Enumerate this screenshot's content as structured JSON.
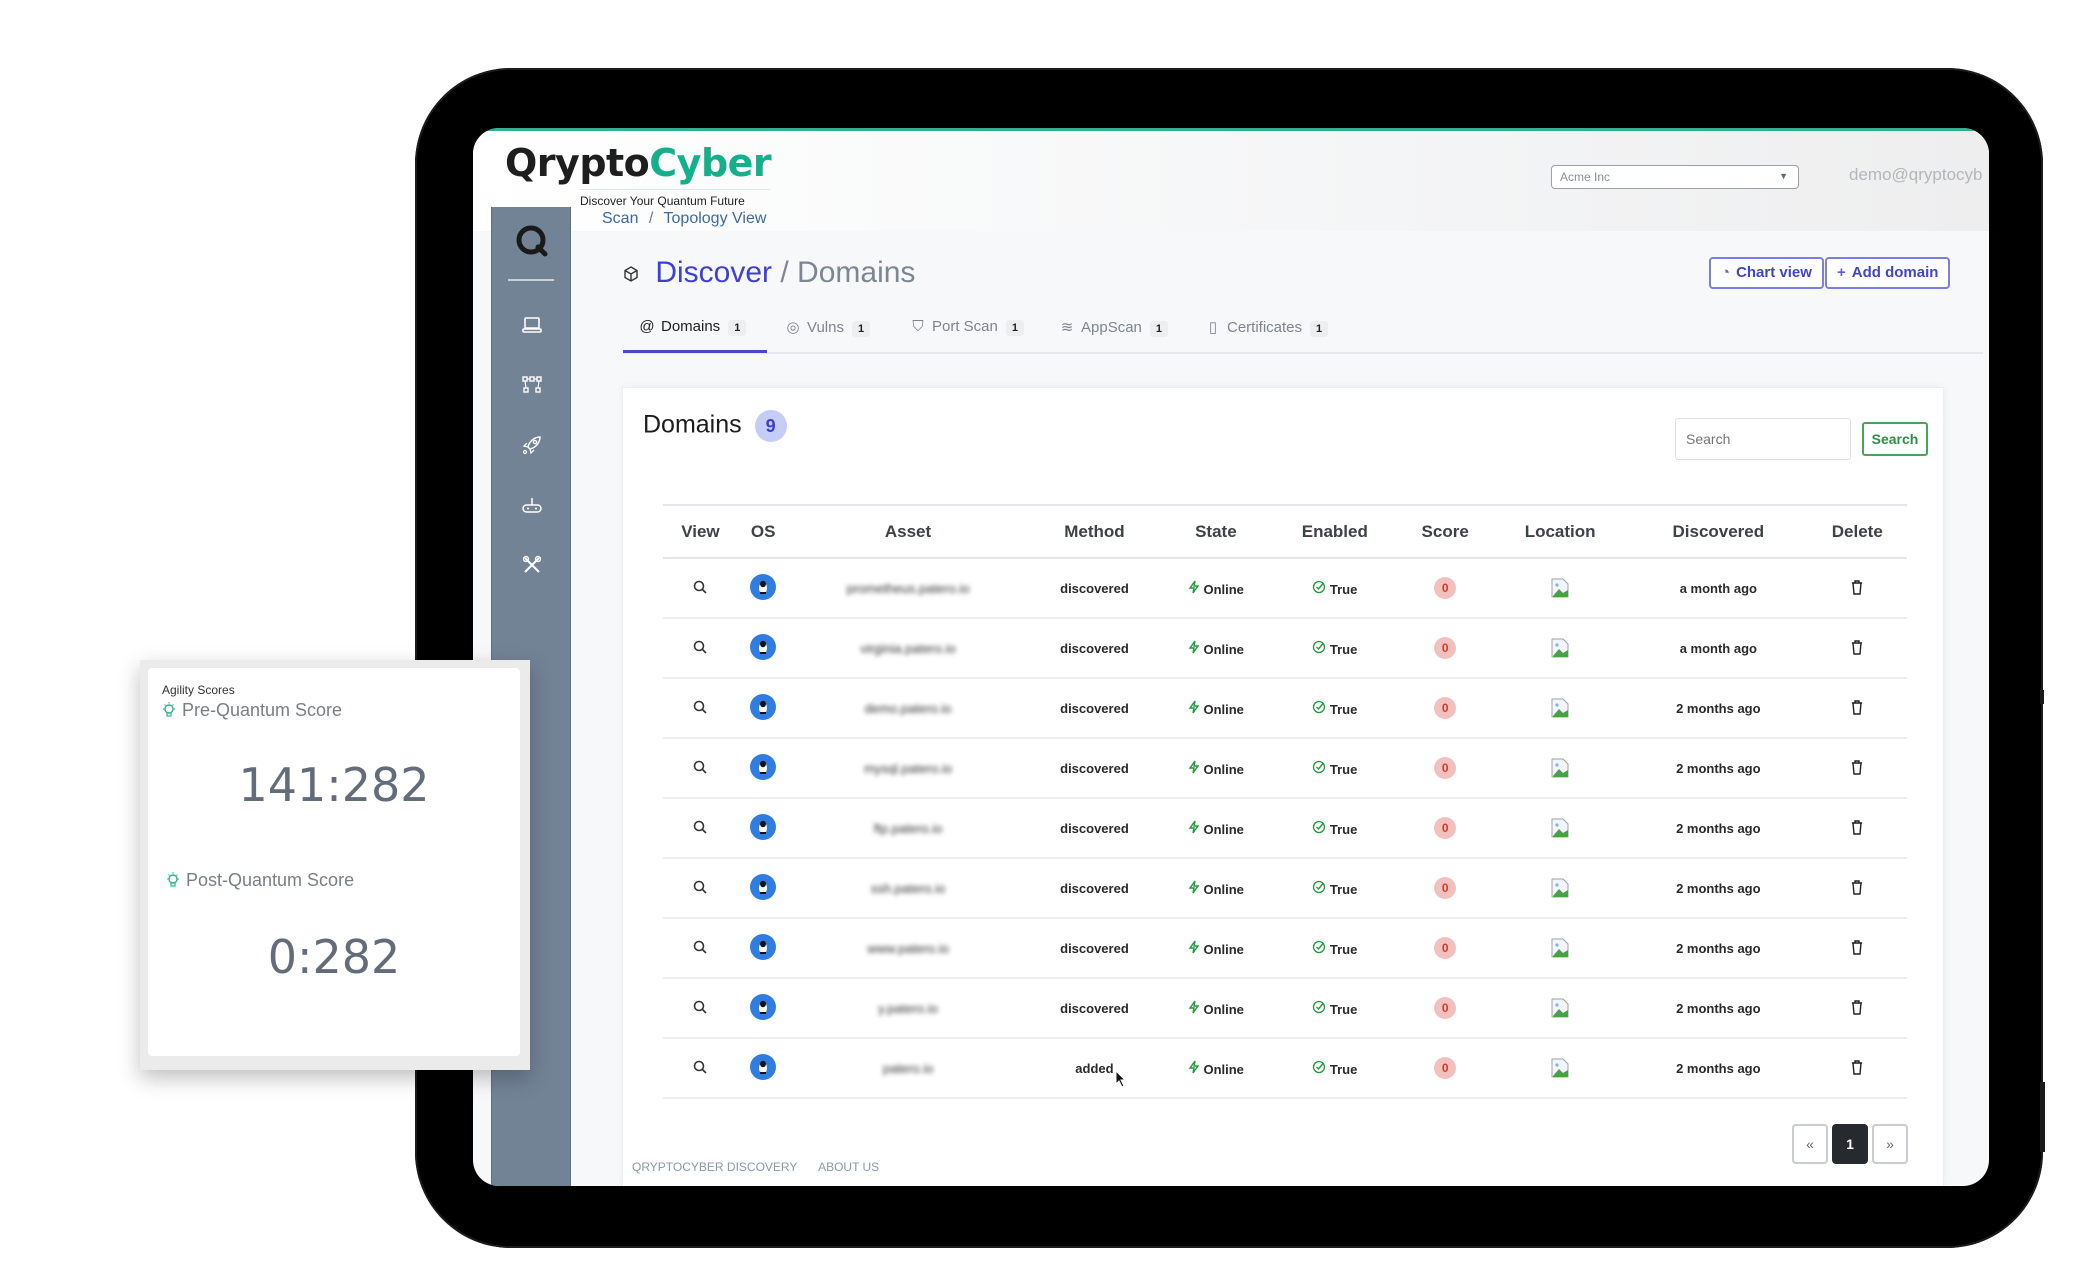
{
  "app": {
    "brand_part1": "Qrypto",
    "brand_part2": "Cyber",
    "tagline": "Discover Your Quantum Future",
    "org_selector": "Acme Inc",
    "user_email": "demo@qryptocyb",
    "accent_color": "#14b08c"
  },
  "breadcrumb": [
    "Scan",
    "/",
    "Topology View"
  ],
  "sidebar": {
    "items": [
      {
        "icon": "laptop-icon"
      },
      {
        "icon": "network-nodes-icon"
      },
      {
        "icon": "rocket-icon"
      },
      {
        "icon": "gamepad-icon"
      },
      {
        "icon": "tools-icon"
      }
    ]
  },
  "page": {
    "title_primary": "Discover",
    "title_secondary": "/ Domains",
    "chart_view_label": "Chart view",
    "add_domain_label": "Add domain"
  },
  "tabs": [
    {
      "label": "Domains",
      "count": "1",
      "icon": "@",
      "active": true
    },
    {
      "label": "Vulns",
      "count": "1",
      "icon": "◎",
      "active": false
    },
    {
      "label": "Port Scan",
      "count": "1",
      "icon": "⛉",
      "active": false
    },
    {
      "label": "AppScan",
      "count": "1",
      "icon": "≋",
      "active": false
    },
    {
      "label": "Certificates",
      "count": "1",
      "icon": "▯",
      "active": false
    }
  ],
  "domains_card": {
    "title": "Domains",
    "count": "9",
    "search_placeholder": "Search",
    "search_button": "Search",
    "columns": [
      "View",
      "OS",
      "Asset",
      "Method",
      "State",
      "Enabled",
      "Score",
      "Location",
      "Discovered",
      "Delete"
    ],
    "rows": [
      {
        "asset": "prometheus.patero.io",
        "method": "discovered",
        "state": "Online",
        "enabled": "True",
        "score": "0",
        "discovered": "a month ago"
      },
      {
        "asset": "virginia.patero.io",
        "method": "discovered",
        "state": "Online",
        "enabled": "True",
        "score": "0",
        "discovered": "a month ago"
      },
      {
        "asset": "demo.patero.io",
        "method": "discovered",
        "state": "Online",
        "enabled": "True",
        "score": "0",
        "discovered": "2 months ago"
      },
      {
        "asset": "mysql.patero.io",
        "method": "discovered",
        "state": "Online",
        "enabled": "True",
        "score": "0",
        "discovered": "2 months ago"
      },
      {
        "asset": "ftp.patero.io",
        "method": "discovered",
        "state": "Online",
        "enabled": "True",
        "score": "0",
        "discovered": "2 months ago"
      },
      {
        "asset": "ssh.patero.io",
        "method": "discovered",
        "state": "Online",
        "enabled": "True",
        "score": "0",
        "discovered": "2 months ago"
      },
      {
        "asset": "www.patero.io",
        "method": "discovered",
        "state": "Online",
        "enabled": "True",
        "score": "0",
        "discovered": "2 months ago"
      },
      {
        "asset": "y.patero.io",
        "method": "discovered",
        "state": "Online",
        "enabled": "True",
        "score": "0",
        "discovered": "2 months ago"
      },
      {
        "asset": "patero.io",
        "method": "added",
        "state": "Online",
        "enabled": "True",
        "score": "0",
        "discovered": "2 months ago"
      }
    ],
    "pagination": {
      "prev": "«",
      "current": "1",
      "next": "»"
    }
  },
  "footer": {
    "links": [
      "QRYPTOCYBER DISCOVERY",
      "ABOUT US"
    ]
  },
  "agility_scores": {
    "title": "Agility Scores",
    "pre_label": "Pre-Quantum Score",
    "pre_value": "141:282",
    "post_label": "Post-Quantum Score",
    "post_value": "0:282"
  }
}
